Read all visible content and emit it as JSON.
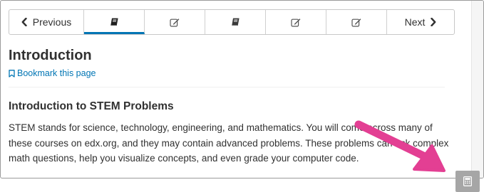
{
  "nav": {
    "previous_label": "Previous",
    "next_label": "Next",
    "tabs": [
      {
        "icon": "book-icon",
        "active": true
      },
      {
        "icon": "edit-icon",
        "active": false
      },
      {
        "icon": "book-icon",
        "active": false
      },
      {
        "icon": "edit-icon",
        "active": false
      },
      {
        "icon": "edit-icon",
        "active": false
      }
    ]
  },
  "page": {
    "title": "Introduction",
    "bookmark_label": "Bookmark this page",
    "subtitle": "Introduction to STEM Problems",
    "body": "STEM stands for science, technology, engineering, and mathematics. You will come across many of these courses on edx.org, and they may contain advanced problems. These problems can ask complex math questions, help you visualize concepts, and even grade your computer code."
  },
  "overlay": {
    "calculator_icon": "calculator-icon",
    "annotation": "arrow-annotation"
  },
  "colors": {
    "accent": "#0075b4",
    "text": "#313131",
    "annotation_arrow": "#e33f93",
    "calculator_bg": "#a6a6a6"
  }
}
